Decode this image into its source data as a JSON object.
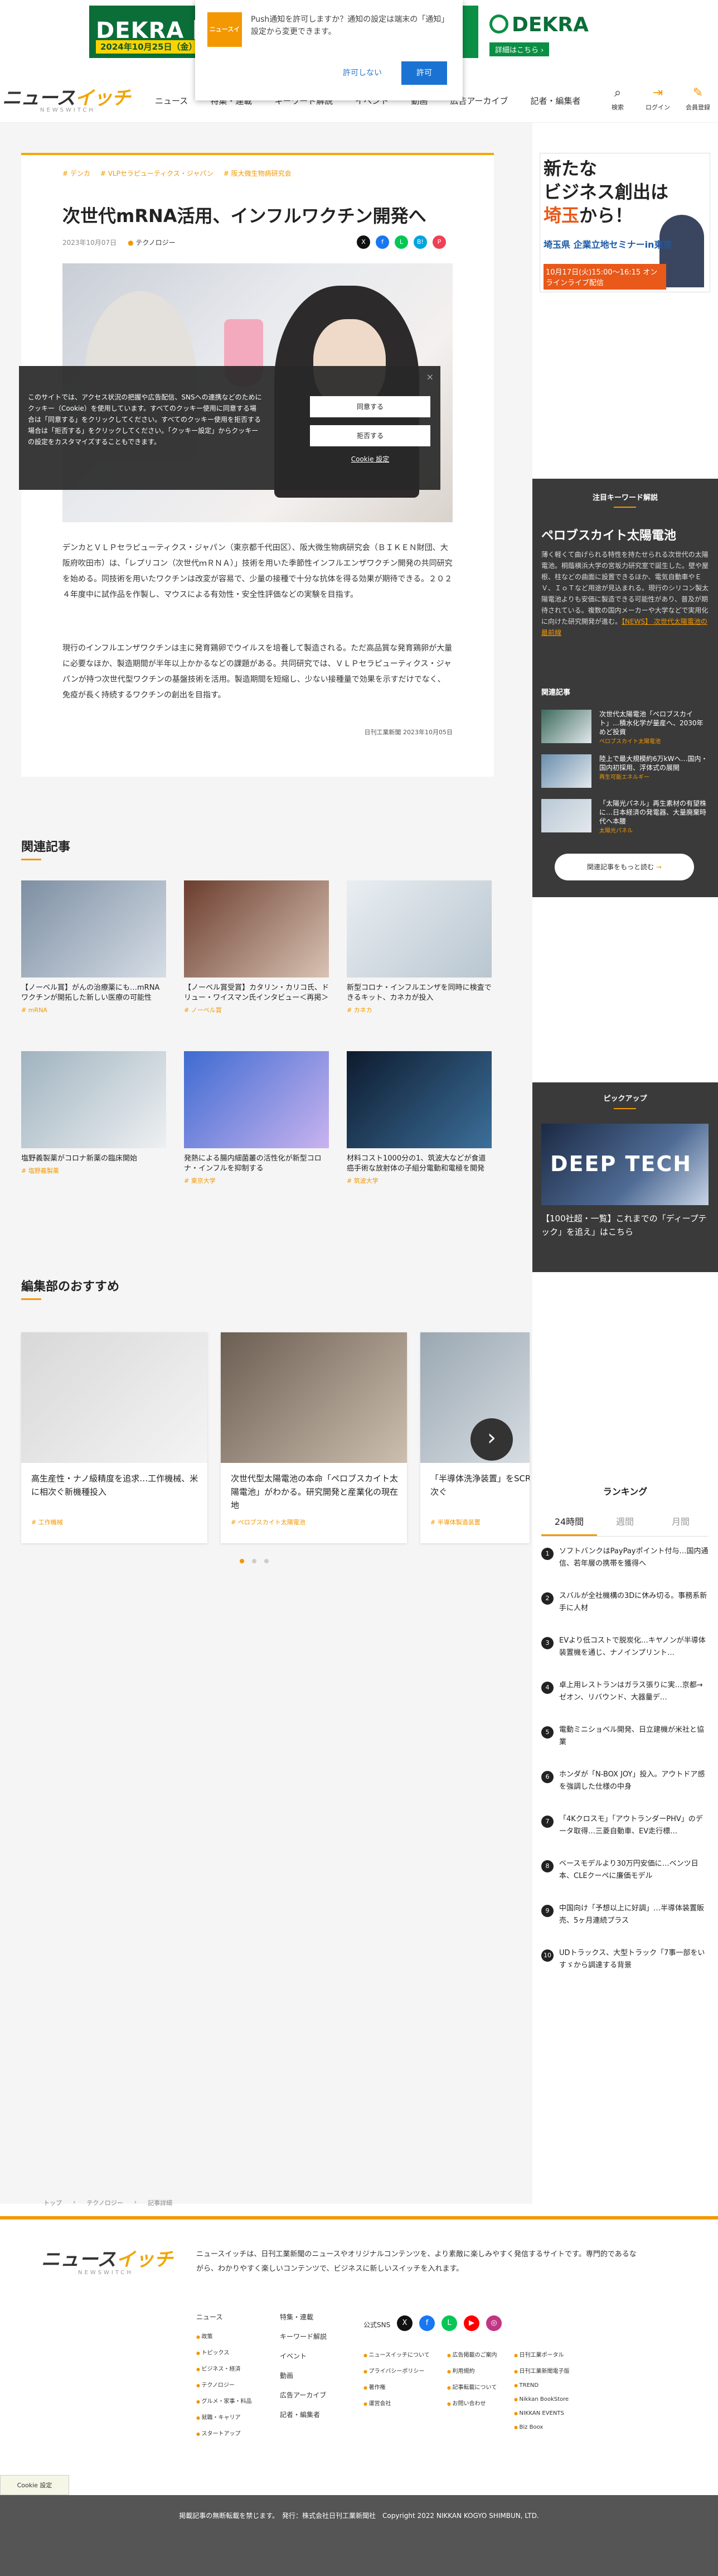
{
  "top_banner": {
    "left_title": "DEKRA 医療",
    "left_date": "2024年10月25日（金）",
    "right_logo": "DEKRA",
    "right_more": "詳細はこちら ›"
  },
  "push_dialog": {
    "logo_text": "ニュースイッチ",
    "message": "Push通知を許可しますか？通知の設定は端末の「通知」設定から変更できます。",
    "deny": "許可しない",
    "allow": "許可"
  },
  "header": {
    "logo_main": "ニュース",
    "logo_accent": "イッチ",
    "logo_sub": "NEWSWITCH",
    "nav": [
      "ニュース",
      "特集・連載",
      "キーワード解説",
      "イベント",
      "動画",
      "広告アーカイブ",
      "記者・編集者"
    ],
    "icons": [
      {
        "icon": "search-icon",
        "glyph": "⌕",
        "label": "検索"
      },
      {
        "icon": "login-icon",
        "glyph": "⇥",
        "label": "ログイン"
      },
      {
        "icon": "member-icon",
        "glyph": "✎",
        "label": "会員登録"
      }
    ]
  },
  "article": {
    "tags": [
      "# デンカ",
      "# VLPセラピューティクス・ジャパン",
      "# 阪大微生物病研究会"
    ],
    "title": "次世代mRNA活用、インフルワクチン開発へ",
    "date": "2023年10月07日",
    "category": "テクノロジー",
    "share": [
      {
        "icon": "x-share-icon",
        "glyph": "X",
        "color": "#111111"
      },
      {
        "icon": "facebook-share-icon",
        "glyph": "f",
        "color": "#1877f2"
      },
      {
        "icon": "line-share-icon",
        "glyph": "L",
        "color": "#06c755"
      },
      {
        "icon": "hatena-share-icon",
        "glyph": "B!",
        "color": "#00a4de"
      },
      {
        "icon": "pocket-share-icon",
        "glyph": "P",
        "color": "#ef4056"
      }
    ],
    "paragraph_1": "デンカとＶＬＰセラピューティクス・ジャパン（東京都千代田区）、阪大微生物病研究会（ＢＩＫＥＮ財団、大阪府吹田市）は、「レプリコン（次世代ｍＲＮＡ）」技術を用いた季節性インフルエンザワクチン開発の共同研究を始める。同技術を用いたワクチンは改変が容易で、少量の接種で十分な抗体を得る効果が期待できる。２０２４年度中に試作品を作製し、マウスによる有効性・安全性評価などの実験を目指す。",
    "paragraph_2": "現行のインフルエンザワクチンは主に発育鶏卵でウイルスを培養して製造される。ただ高品質な発育鶏卵が大量に必要なほか、製造期間が半年以上かかるなどの課題がある。共同研究では、ＶＬＰセラピューティクス・ジャパンが持つ次世代型ワクチンの基盤技術を活用。製造期間を短縮し、少ない接種量で効果を示すだけでなく、免疫が長く持続するワクチンの創出を目指す。",
    "source": "日刊工業新聞 2023年10月05日"
  },
  "cookie_banner": {
    "text": "このサイトでは、アクセス状況の把握や広告配信、SNSへの連携などのためにクッキー（Cookie）を使用しています。すべてのクッキー使用に同意する場合は「同意する」をクリックしてください。すべてのクッキー使用を拒否する場合は「拒否する」をクリックしてください。「クッキー設定」からクッキーの設定をカスタマイズすることもできます。",
    "accept": "同意する",
    "reject": "拒否する",
    "settings": "Cookie 設定",
    "close": "×"
  },
  "related": {
    "title": "関連記事",
    "items": [
      {
        "title": "【ノーベル賞】がんの治療薬にも…mRNAワクチンが開拓した新しい医療の可能性",
        "tag": "mRNA",
        "c1": "#7d8fa3",
        "c2": "#d6dde6"
      },
      {
        "title": "【ノーベル賞受賞】カタリン・カリコ氏、ドリュー・ワイスマン氏インタビュー＜再掲＞",
        "tag": "ノーベル賞",
        "c1": "#6b3d2e",
        "c2": "#d9c3b4"
      },
      {
        "title": "新型コロナ・インフルエンザを同時に検査できるキット、カネカが投入",
        "tag": "カネカ",
        "c1": "#e9eef2",
        "c2": "#b9c6d0"
      },
      {
        "title": "塩野義製薬がコロナ新薬の臨床開始",
        "tag": "塩野義製薬",
        "c1": "#9fb3bf",
        "c2": "#eef0f2"
      },
      {
        "title": "発熱による腸内細菌叢の活性化が新型コロナ・インフルを抑制する",
        "tag": "東京大学",
        "c1": "#3e6bd1",
        "c2": "#c9b3ef"
      },
      {
        "title": "材料コスト1000分の1、筑波大などが食道癌手術な放射体の子組分電動和電極を開発",
        "tag": "筑波大学",
        "c1": "#0d1b2e",
        "c2": "#3c6f9a"
      }
    ]
  },
  "recommend": {
    "title": "編集部のおすすめ",
    "items": [
      {
        "title": "高生産性・ナノ級精度を追求…工作機械、米に相次ぐ新機種投入",
        "tag": "工作機械",
        "c1": "#d8d8d8",
        "c2": "#f4f4f4"
      },
      {
        "title": "次世代型太陽電池の本命「ペロブスカイト太陽電池」がわかる。研究開発と産業化の現在地",
        "tag": "ペロブスカイト太陽電池",
        "c1": "#6b5e52",
        "c2": "#cdbfaf"
      },
      {
        "title": "「半導体洗浄装置」をSCREEN HD、新棟相次ぐ",
        "tag": "半導体製造装置",
        "c1": "#9aa7b2",
        "c2": "#d7dde2"
      }
    ],
    "next": "›"
  },
  "side_ad": {
    "line1": "新たな",
    "line2": "ビジネス創出は",
    "line3_accent": "埼玉",
    "line3_rest": "から！",
    "line4": "埼玉県 企業立地セミナーin東京",
    "line5": "10月17日(火)15:00〜16:15 オンラインライブ配信"
  },
  "keyword": {
    "header": "注目キーワード解説",
    "title": "ペロブスカイト太陽電池",
    "desc": "薄く軽くて曲げられる特性を持たせられる次世代の太陽電池。桐蔭横浜大学の宮坂力研究室で誕生した。壁や屋根、柱などの曲面に設置できるほか、電気自動車やＥＶ、ＩｏＴなど用途が見込まれる。現行のシリコン製太陽電池よりも安価に製造できる可能性があり、普及が期待されている。複数の国内メーカーや大学などで実用化に向けた研究開発が進む。",
    "desc_link": "【NEWS】 次世代太陽電池の最前線",
    "related_label": "関連記事",
    "items": [
      {
        "title": "次世代太陽電池「ペロブスカイト」…積水化学が量産へ、2030年めど投資",
        "tag": "ペロブスカイト太陽電池"
      },
      {
        "title": "陸上で最大規模約6万kWへ…国内・国内初採用、浮体式の展開",
        "tag": "再生可能エネルギー"
      },
      {
        "title": "「太陽光パネル」再生素材の有望株に…日本経済の発電器、大量廃棄時代へ本腰",
        "tag": "太陽光パネル"
      }
    ],
    "more": "関連記事をもっと読む",
    "more_arrow": "→"
  },
  "pickup": {
    "header": "ピックアップ",
    "image_text": "DEEP TECH",
    "title": "【100社超・一覧】これまでの「ディープテック」を追え」はこちら"
  },
  "ranking": {
    "title": "ランキング",
    "tabs": [
      "24時間",
      "週間",
      "月間"
    ],
    "items": [
      "ソフトバンクはPayPayポイント付与…国内通信、若年層の携帯を獲得へ",
      "スバルが全社機構の3Dに休み切る。事務系新手に人材",
      "EVより低コストで脱炭化…キヤノンが半導体装置機を通じ、ナノインプリント…",
      "卓上用レストランはガラス張りに実…京都→ゼオン、リバウンド、大器量デ…",
      "電動ミニショベル開発、日立建機が米社と協業",
      "ホンダが「N-BOX JOY」投入。アウトドア感を強調した仕様の中身",
      "「4Kクロスモ」「アウトランダーPHV」のデータ取得…三菱自動車、EV走行標…",
      "ベースモデルより30万円安価に…ベンツ日本、CLEクーペに廉価モデル",
      "中国向け「予想以上に好調」…半導体装置販売、5ヶ月連続プラス",
      "UDトラックス、大型トラック「7事一部をいすゞから調達する背景"
    ]
  },
  "breadcrumb": [
    "トップ",
    "テクノロジー",
    "記事詳細"
  ],
  "footer": {
    "logo_main": "ニュース",
    "logo_accent": "イッチ",
    "logo_sub": "NEWSWITCH",
    "desc": "ニュースイッチは、日刊工業新聞のニュースやオリジナルコンテンツを、より素敵に楽しみやすく発信するサイトです。専門的であるながら、わかりやすく楽しいコンテンツで、ビジネスに新しいスイッチを入れます。",
    "col1": [
      "ニュース",
      "政策",
      "トピックス",
      "ビジネス・経済",
      "テクノロジー",
      "グルメ・家事・料品",
      "就職・キャリア",
      "スタートアップ"
    ],
    "col2": [
      "特集・連載",
      "キーワード解説",
      "イベント",
      "動画",
      "広告アーカイブ",
      "記者・編集者"
    ],
    "sns_label": "公式SNS",
    "sns": [
      {
        "icon": "x-icon",
        "glyph": "X",
        "color": "#111111"
      },
      {
        "icon": "facebook-icon",
        "glyph": "f",
        "color": "#1877f2"
      },
      {
        "icon": "line-icon",
        "glyph": "L",
        "color": "#06c755"
      },
      {
        "icon": "youtube-icon",
        "glyph": "▶",
        "color": "#ff0000"
      },
      {
        "icon": "instagram-icon",
        "glyph": "◎",
        "color": "#c13584"
      }
    ],
    "col3": [
      "ニュースイッチについて",
      "プライバシーポリシー",
      "著作権",
      "運営会社"
    ],
    "col4": [
      "広告掲載のご案内",
      "利用規約",
      "記事転載について",
      "お問い合わせ"
    ],
    "col5": [
      "日刊工業ポータル",
      "日刊工業新聞電子版",
      "TREND",
      "Nikkan BookStore",
      "NIKKAN EVENTS",
      "Biz Boox"
    ],
    "cookie_settings": "Cookie 設定",
    "copyright": "掲載記事の無断転載を禁じます。　発行：株式会社日刊工業新聞社　Copyright 2022 NIKKAN KOGYO SHIMBUN, LTD."
  }
}
